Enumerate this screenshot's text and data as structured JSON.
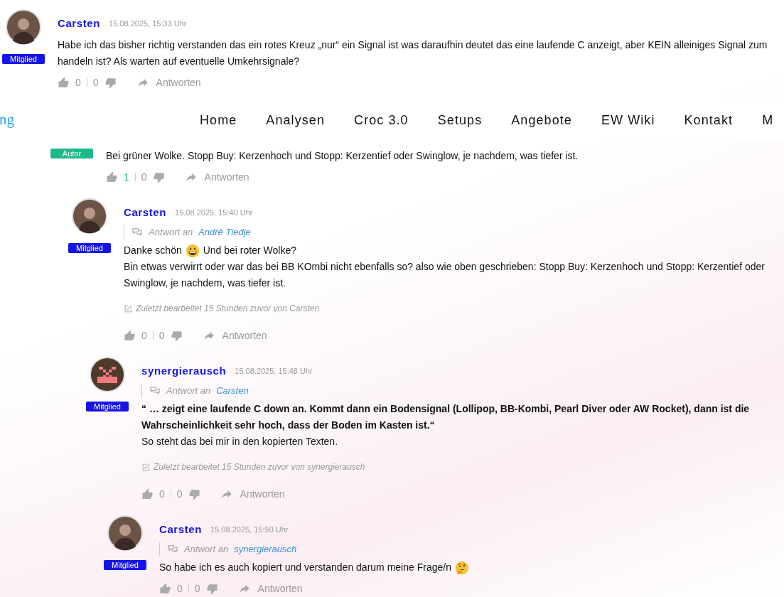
{
  "nav": {
    "logo": "ng",
    "items": [
      "Home",
      "Analysen",
      "Croc 3.0",
      "Setups",
      "Angebote",
      "EW Wiki",
      "Kontakt",
      "M"
    ]
  },
  "comments": [
    {
      "author": "Carsten",
      "avatar": {
        "kind": "photo"
      },
      "badge": {
        "label": "Mitglied",
        "kind": "member"
      },
      "time": "15.08.2025, 15:33 Uhr",
      "paragraphs": [
        {
          "parts": [
            {
              "kind": "text",
              "text": "Habe ich das bisher richtig verstanden das ein rotes Kreuz „nur“ ein Signal ist was daraufhin deutet das eine laufende C anzeigt, aber KEIN alleiniges Signal zum handeln ist? Als warten auf eventuelle Umkehrsignale?"
            }
          ]
        }
      ],
      "likes": "0",
      "dislikes": "0",
      "reply": "Antworten",
      "children": [
        {
          "badge": {
            "label": "Autor",
            "kind": "author"
          },
          "paragraphs": [
            {
              "parts": [
                {
                  "kind": "text",
                  "text": "Bei grüner Wolke. Stopp Buy: Kerzenhoch und Stopp: Kerzentief oder Swinglow, je nachdem, was tiefer ist."
                }
              ]
            }
          ],
          "likes": "1",
          "liked": true,
          "dislikes": "0",
          "reply": "Antworten",
          "children": [
            {
              "author": "Carsten",
              "avatar": {
                "kind": "photo"
              },
              "badge": {
                "label": "Mitglied",
                "kind": "member"
              },
              "time": "15.08.2025, 15:40 Uhr",
              "reply_to": {
                "label": "Antwort an",
                "name": "André Tiedje"
              },
              "paragraphs": [
                {
                  "parts": [
                    {
                      "kind": "text",
                      "text": "Danke schön"
                    },
                    {
                      "kind": "grin"
                    },
                    {
                      "kind": "text",
                      "text": "Und bei roter Wolke?"
                    }
                  ]
                },
                {
                  "parts": [
                    {
                      "kind": "text",
                      "text": "Bin etwas verwirrt oder war das bei BB KOmbi nicht ebenfalls so? also wie oben geschrieben: Stopp Buy: Kerzenhoch und Stopp: Kerzentief oder Swinglow, je nachdem, was tiefer ist."
                    }
                  ]
                }
              ],
              "edited": "Zuletzt bearbeitet 15 Stunden zuvor von Carsten",
              "likes": "0",
              "dislikes": "0",
              "reply": "Antworten",
              "children": [
                {
                  "author": "synergierausch",
                  "avatar": {
                    "kind": "pixel"
                  },
                  "badge": {
                    "label": "Mitglied",
                    "kind": "member"
                  },
                  "time": "15.08.2025, 15:48 Uhr",
                  "reply_to": {
                    "label": "Antwort an",
                    "name": "Carsten"
                  },
                  "paragraphs": [
                    {
                      "bold": true,
                      "parts": [
                        {
                          "kind": "text",
                          "text": "“ … zeigt eine laufende C down an. Kommt dann ein Bodensignal (Lollipop, BB-Kombi, Pearl Diver oder AW Rocket), dann ist die Wahrscheinlichkeit sehr hoch, dass der Boden im Kasten ist.“"
                        }
                      ]
                    },
                    {
                      "parts": [
                        {
                          "kind": "text",
                          "text": "So steht das bei mir in den kopierten Texten."
                        }
                      ]
                    }
                  ],
                  "edited": "Zuletzt bearbeitet 15 Stunden zuvor von synergierausch",
                  "likes": "0",
                  "dislikes": "0",
                  "reply": "Antworten",
                  "children": [
                    {
                      "author": "Carsten",
                      "avatar": {
                        "kind": "photo"
                      },
                      "badge": {
                        "label": "Mitglied",
                        "kind": "member"
                      },
                      "time": "15.08.2025, 15:50 Uhr",
                      "reply_to": {
                        "label": "Antwort an",
                        "name": "synergierausch"
                      },
                      "paragraphs": [
                        {
                          "parts": [
                            {
                              "kind": "text",
                              "text": "So habe ich es auch kopiert und verstanden darum meine Frage/n"
                            },
                            {
                              "kind": "thinking"
                            }
                          ]
                        }
                      ],
                      "likes": "0",
                      "dislikes": "0",
                      "reply": "Antworten"
                    }
                  ]
                }
              ]
            }
          ]
        }
      ]
    }
  ]
}
